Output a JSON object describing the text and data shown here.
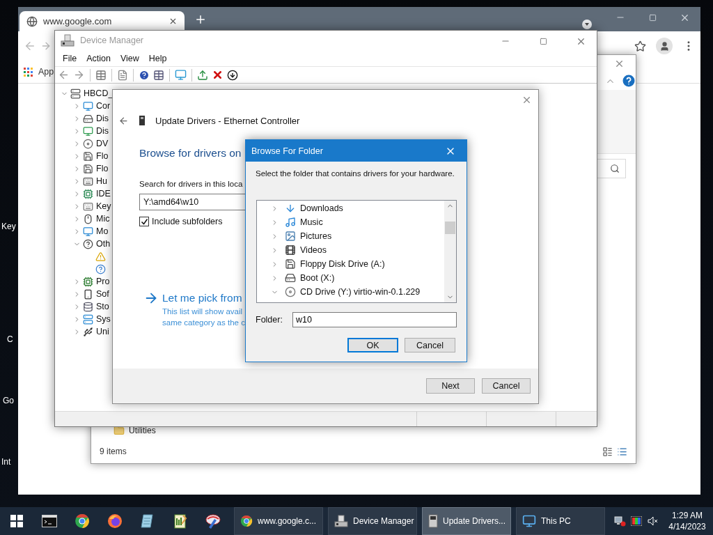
{
  "desktop": {
    "icon_labels": [
      "Key",
      "C",
      "Go",
      "Int"
    ]
  },
  "browser": {
    "tab": {
      "title": "www.google.com",
      "selected": true
    },
    "bookmarks": [
      "App"
    ]
  },
  "explorer": {
    "items": [
      "Utilities"
    ],
    "status": "9 items"
  },
  "device_manager": {
    "title": "Device Manager",
    "menu": [
      "File",
      "Action",
      "View",
      "Help"
    ],
    "tree": [
      {
        "label": "HBCD_",
        "kind": "root",
        "expanded": true,
        "children": [
          {
            "label": "Cor",
            "kind": "computer",
            "expanded": false
          },
          {
            "label": "Dis",
            "kind": "disk",
            "expanded": false
          },
          {
            "label": "Dis",
            "kind": "display",
            "expanded": false
          },
          {
            "label": "DV",
            "kind": "dvd",
            "expanded": false
          },
          {
            "label": "Flo",
            "kind": "floppy",
            "expanded": false
          },
          {
            "label": "Flo",
            "kind": "floppy",
            "expanded": false
          },
          {
            "label": "Hu",
            "kind": "hid",
            "expanded": false
          },
          {
            "label": "IDE",
            "kind": "ide",
            "expanded": false
          },
          {
            "label": "Key",
            "kind": "keyboard",
            "expanded": false
          },
          {
            "label": "Mic",
            "kind": "mouse",
            "expanded": false
          },
          {
            "label": "Mo",
            "kind": "monitor",
            "expanded": false
          },
          {
            "label": "Oth",
            "kind": "other",
            "expanded": true,
            "children": [
              {
                "kind": "warning"
              },
              {
                "kind": "unknown"
              }
            ]
          },
          {
            "label": "Pro",
            "kind": "processor",
            "expanded": false
          },
          {
            "label": "Sof",
            "kind": "software",
            "expanded": false
          },
          {
            "label": "Sto",
            "kind": "storage",
            "expanded": false
          },
          {
            "label": "Sys",
            "kind": "system",
            "expanded": false
          },
          {
            "label": "Uni",
            "kind": "usb",
            "expanded": false
          }
        ]
      }
    ]
  },
  "update_drivers": {
    "title": "Update Drivers - Ethernet Controller",
    "heading": "Browse for drivers on",
    "search_label": "Search for drivers in this loca",
    "path": "Y:\\amd64\\w10",
    "include_subfolders": {
      "label": "Include subfolders",
      "checked": true
    },
    "pick_link": "Let me pick from",
    "pick_description": [
      "This list will show avail",
      "same category as the c"
    ],
    "buttons": [
      "Next",
      "Cancel"
    ]
  },
  "browse_folder": {
    "title": "Browse For Folder",
    "instruction": "Select the folder that contains drivers for your hardware.",
    "folders": [
      {
        "label": "Downloads",
        "kind": "downloads",
        "expanded": false
      },
      {
        "label": "Music",
        "kind": "music",
        "expanded": false
      },
      {
        "label": "Pictures",
        "kind": "pictures",
        "expanded": false
      },
      {
        "label": "Videos",
        "kind": "videos",
        "expanded": false
      },
      {
        "label": "Floppy Disk Drive (A:)",
        "kind": "floppy",
        "expanded": false
      },
      {
        "label": "Boot (X:)",
        "kind": "drive",
        "expanded": false
      },
      {
        "label": "CD Drive (Y:) virtio-win-0.1.229",
        "kind": "cd",
        "expanded": true
      }
    ],
    "folder_label": "Folder:",
    "folder_value": "w10",
    "buttons": [
      {
        "label": "OK",
        "default": true
      },
      {
        "label": "Cancel",
        "default": false
      }
    ]
  },
  "taskbar": {
    "pinned": [
      {
        "kind": "terminal"
      },
      {
        "kind": "chrome"
      },
      {
        "kind": "firefox"
      },
      {
        "kind": "notepad"
      },
      {
        "kind": "editor"
      },
      {
        "kind": "tool"
      }
    ],
    "tasks": [
      {
        "label": "www.google.c...",
        "kind": "chrome",
        "selected": false
      },
      {
        "label": "Device Manager",
        "kind": "devmgr",
        "selected": false
      },
      {
        "label": "Update Drivers...",
        "kind": "driver",
        "selected": true
      },
      {
        "label": "This PC",
        "kind": "pc",
        "selected": false
      }
    ],
    "clock": {
      "time": "1:29 AM",
      "date": "4/14/2023"
    }
  }
}
